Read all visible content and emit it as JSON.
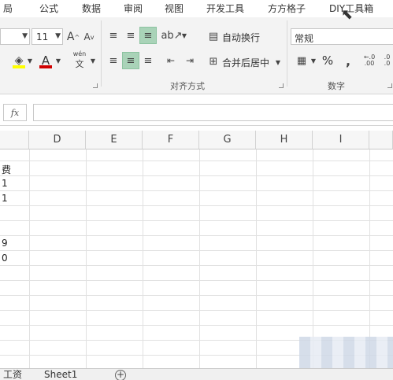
{
  "ribbon_tabs": [
    "局",
    "公式",
    "数据",
    "审阅",
    "视图",
    "开发工具",
    "方方格子",
    "DIY工具箱"
  ],
  "font": {
    "size_value": "11"
  },
  "alignment": {
    "wrap_text_label": "自动换行",
    "merge_center_label": "合并后居中",
    "group_label": "对齐方式"
  },
  "number": {
    "format_value": "常规",
    "group_label": "数字",
    "percent_symbol": "%"
  },
  "pinyin_label": "wén",
  "formula_bar": {
    "fx_label": "fx",
    "value": ""
  },
  "columns": [
    "D",
    "E",
    "F",
    "G",
    "H",
    "I"
  ],
  "left_cells": [
    "费",
    "1",
    "1",
    "9",
    "0"
  ],
  "sheet_tabs": [
    "工资",
    "Sheet1"
  ],
  "add_sheet_symbol": "+",
  "colors": {
    "active_align": "#a9d3b8",
    "font_color_bar": "#d00000",
    "fill_color_bar": "#ffff00"
  }
}
